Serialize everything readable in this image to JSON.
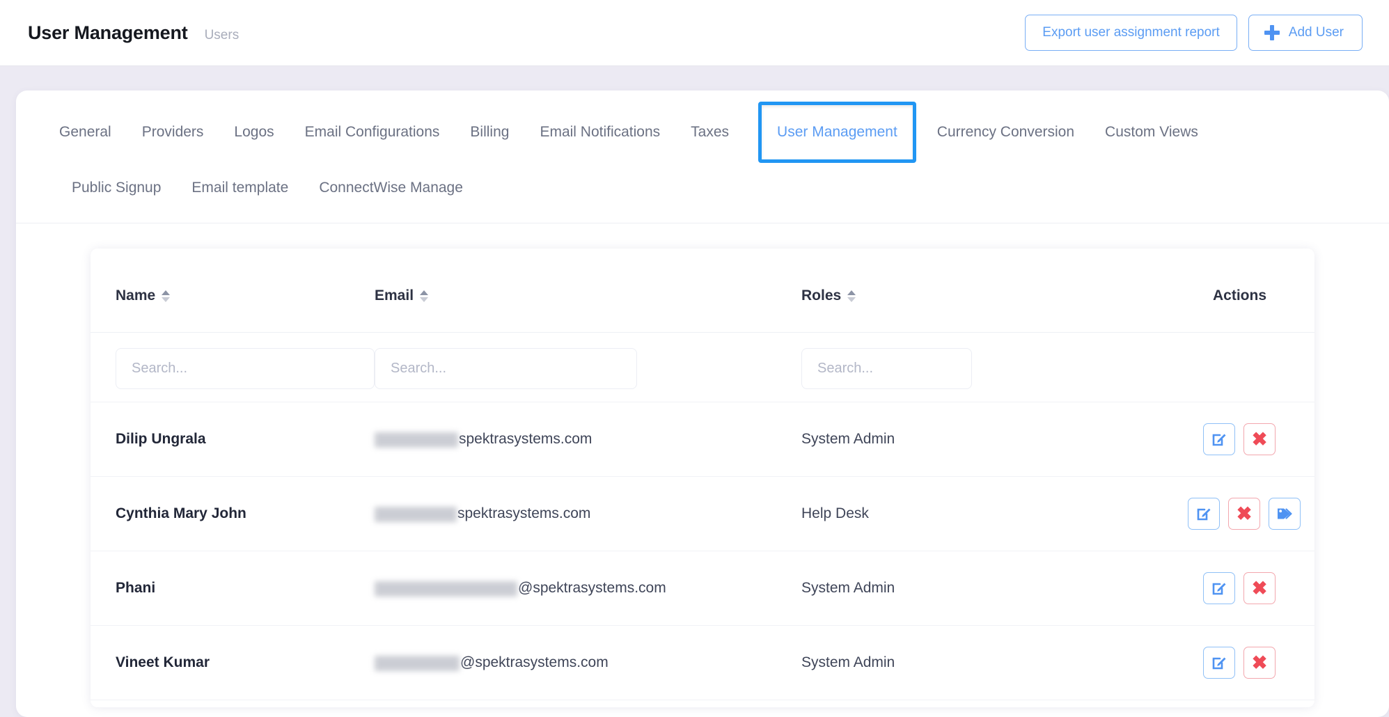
{
  "header": {
    "title": "User Management",
    "breadcrumb": "Users",
    "export_button": "Export user assignment report",
    "add_user_button": "Add User",
    "add_user_icon": "plus-icon"
  },
  "tabs": {
    "row1": [
      {
        "label": "General",
        "active": false
      },
      {
        "label": "Providers",
        "active": false
      },
      {
        "label": "Logos",
        "active": false
      },
      {
        "label": "Email Configurations",
        "active": false
      },
      {
        "label": "Billing",
        "active": false
      },
      {
        "label": "Email Notifications",
        "active": false
      },
      {
        "label": "Taxes",
        "active": false
      },
      {
        "label": "User Management",
        "active": true
      },
      {
        "label": "Currency Conversion",
        "active": false
      },
      {
        "label": "Custom Views",
        "active": false
      }
    ],
    "row2": [
      {
        "label": "Public Signup",
        "active": false
      },
      {
        "label": "Email template",
        "active": false
      },
      {
        "label": "ConnectWise Manage",
        "active": false
      }
    ]
  },
  "table": {
    "columns": [
      {
        "label": "Name",
        "sortable": true
      },
      {
        "label": "Email",
        "sortable": true
      },
      {
        "label": "Roles",
        "sortable": true
      },
      {
        "label": "Actions",
        "sortable": false
      }
    ],
    "filters": {
      "name_placeholder": "Search...",
      "email_placeholder": "Search...",
      "roles_placeholder": "Search..."
    },
    "rows": [
      {
        "name": "Dilip Ungrala",
        "email_redacted_width": 120,
        "email_visible": "spektrasystems.com",
        "roles": "System Admin",
        "actions": [
          "edit-icon",
          "delete-icon"
        ]
      },
      {
        "name": "Cynthia Mary John",
        "email_redacted_width": 118,
        "email_visible": "spektrasystems.com",
        "roles": "Help Desk",
        "actions": [
          "edit-icon",
          "delete-icon",
          "tag-icon"
        ]
      },
      {
        "name": "Phani",
        "email_redacted_width": 205,
        "email_visible": "@spektrasystems.com",
        "roles": "System Admin",
        "actions": [
          "edit-icon",
          "delete-icon"
        ]
      },
      {
        "name": "Vineet Kumar",
        "email_redacted_width": 122,
        "email_visible": "@spektrasystems.com",
        "roles": "System Admin",
        "actions": [
          "edit-icon",
          "delete-icon"
        ]
      }
    ]
  },
  "colors": {
    "accent_blue": "#5b9cf3",
    "highlight_blue": "#2196f3",
    "danger_red": "#ef4b57",
    "page_bg": "#eceaf3",
    "card_bg": "#ffffff",
    "text_dark": "#222738",
    "text_muted": "#6b7183"
  },
  "icons": {
    "delete_glyph": "✖"
  }
}
